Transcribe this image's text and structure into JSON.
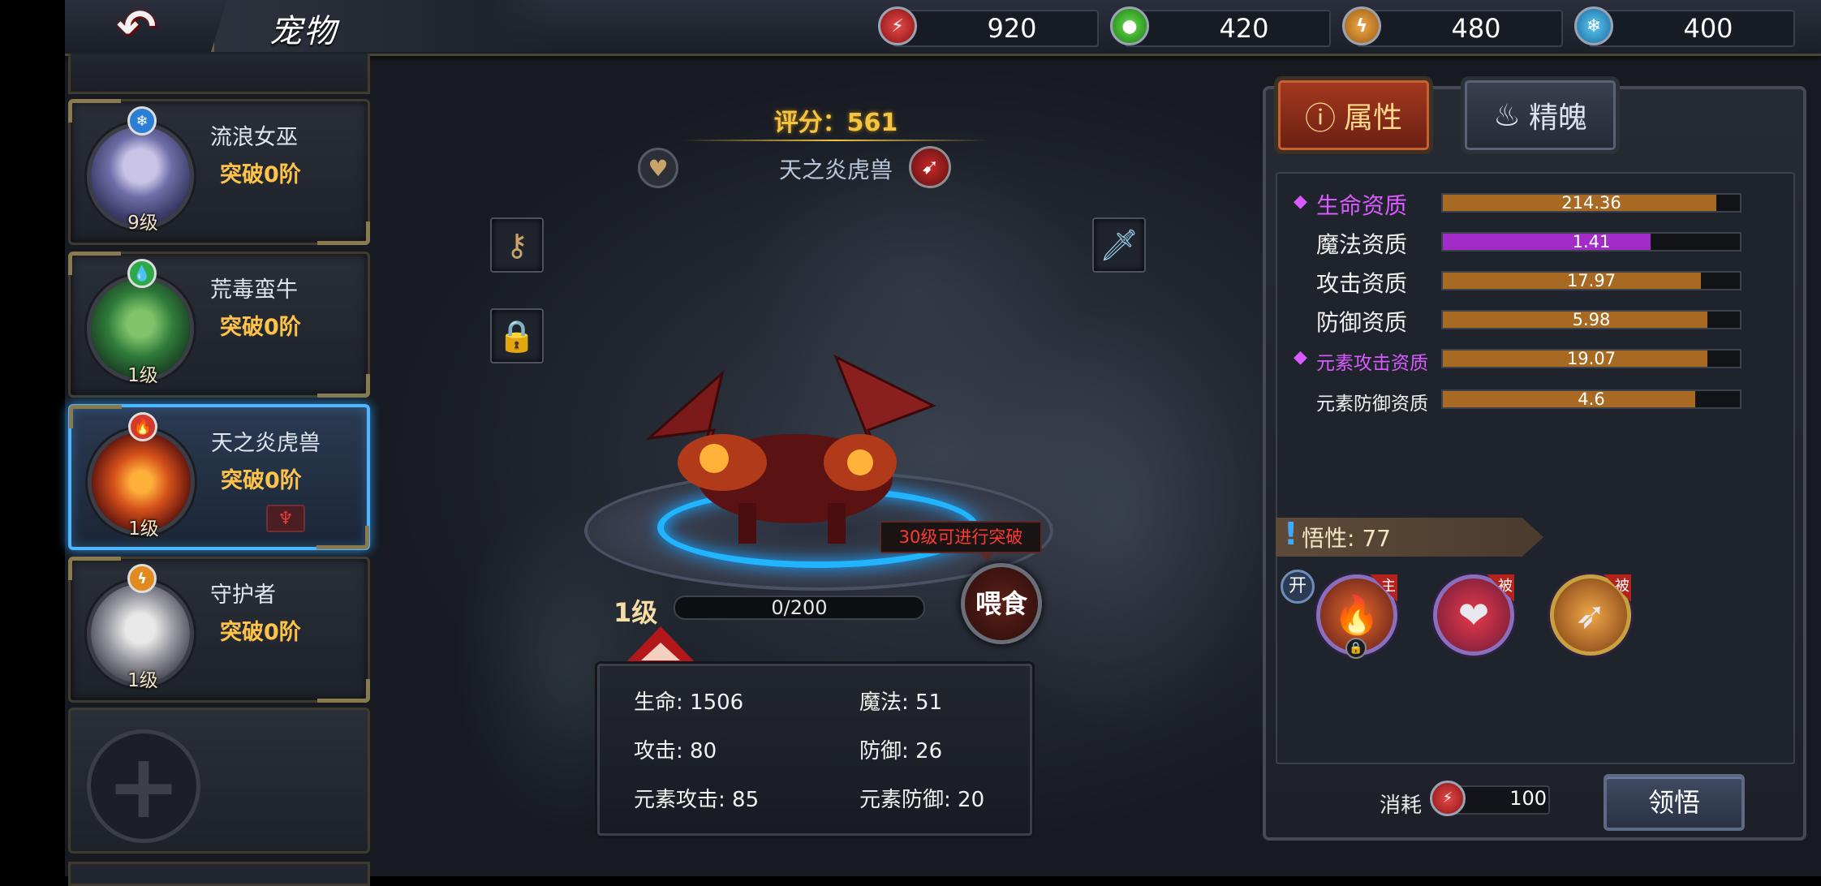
{
  "header": {
    "title": "宠物",
    "back_icon": "back-arrow-icon",
    "resources": [
      {
        "icon": "red-gem-icon",
        "color": "#d42a2a",
        "value": "920"
      },
      {
        "icon": "green-gem-icon",
        "color": "#3bb33b",
        "value": "420"
      },
      {
        "icon": "lightning-gem-icon",
        "color": "#e08a20",
        "value": "480"
      },
      {
        "icon": "snowflake-gem-icon",
        "color": "#2a9ad4",
        "value": "400"
      }
    ]
  },
  "pet_list": [
    {
      "name": "流浪女巫",
      "breakthrough": "突破0阶",
      "level": "9级",
      "element": "snowflake-icon",
      "element_color": "#2a7fd4"
    },
    {
      "name": "荒毒蛮牛",
      "breakthrough": "突破0阶",
      "level": "1级",
      "element": "droplet-icon",
      "element_color": "#2fa84a"
    },
    {
      "name": "天之炎虎兽",
      "breakthrough": "突破0阶",
      "level": "1级",
      "element": "flame-icon",
      "element_color": "#d43a2a",
      "selected": true
    },
    {
      "name": "守护者",
      "breakthrough": "突破0阶",
      "level": "1级",
      "element": "lightning-icon",
      "element_color": "#e08a20"
    }
  ],
  "center": {
    "score": "评分：561",
    "pet_name": "天之炎虎兽",
    "level": "1级",
    "exp": "0/200",
    "exp_fraction": 0,
    "tip": "30级可进行突破",
    "feed_label": "喂食",
    "stats": [
      "生命: 1506",
      "魔法: 51",
      "攻击: 80",
      "防御: 26",
      "元素攻击: 85",
      "元素防御: 20"
    ]
  },
  "right_panel": {
    "tabs": [
      "属性",
      "精魄"
    ],
    "active_tab": "属性",
    "attributes": [
      {
        "name": "生命资质",
        "value": "214.36",
        "fraction": 0.92,
        "highlight": true,
        "color": "#a86a22"
      },
      {
        "name": "魔法资质",
        "value": "1.41",
        "fraction": 0.7,
        "highlight": false,
        "color": "#a22cc8"
      },
      {
        "name": "攻击资质",
        "value": "17.97",
        "fraction": 0.87,
        "highlight": false,
        "color": "#a86a22"
      },
      {
        "name": "防御资质",
        "value": "5.98",
        "fraction": 0.89,
        "highlight": false,
        "color": "#a86a22"
      },
      {
        "name": "元素攻击资质",
        "value": "19.07",
        "fraction": 0.89,
        "highlight": true,
        "color": "#a86a22"
      },
      {
        "name": "元素防御资质",
        "value": "4.6",
        "fraction": 0.85,
        "highlight": false,
        "color": "#a86a22"
      }
    ],
    "wisdom": "悟性: 77",
    "open_label": "开",
    "skills": [
      {
        "icon": "flame-claw-icon",
        "tag": "主",
        "border": "#8b6fbd"
      },
      {
        "icon": "heart-icon",
        "tag": "被",
        "border": "#8b6fbd"
      },
      {
        "icon": "flame-spear-icon",
        "tag": "被",
        "border": "#c9a040"
      }
    ],
    "cost_label": "消耗",
    "cost_value": "100",
    "comprehend_label": "领悟"
  }
}
